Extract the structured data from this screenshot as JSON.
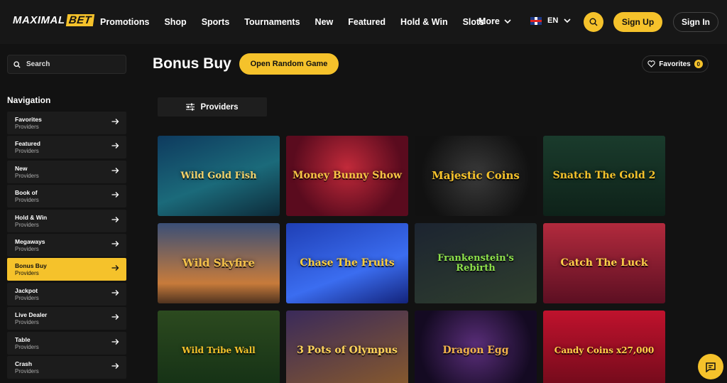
{
  "header": {
    "logo_part1": "MAXIMAL",
    "logo_part2": "BET",
    "nav": [
      "Promotions",
      "Shop",
      "Sports",
      "Tournaments",
      "New",
      "Featured",
      "Hold & Win",
      "Slots"
    ],
    "more_label": "More",
    "language": "EN",
    "signup_label": "Sign Up",
    "signin_label": "Sign In"
  },
  "sidebar": {
    "search_placeholder": "Search",
    "nav_title": "Navigation",
    "items": [
      {
        "label": "Favorites",
        "sub": "Providers"
      },
      {
        "label": "Featured",
        "sub": "Providers"
      },
      {
        "label": "New",
        "sub": "Providers"
      },
      {
        "label": "Book of",
        "sub": "Providers"
      },
      {
        "label": "Hold & Win",
        "sub": "Providers"
      },
      {
        "label": "Megaways",
        "sub": "Providers"
      },
      {
        "label": "Bonus Buy",
        "sub": "Providers"
      },
      {
        "label": "Jackpot",
        "sub": "Providers"
      },
      {
        "label": "Live Dealer",
        "sub": "Providers"
      },
      {
        "label": "Table",
        "sub": "Providers"
      },
      {
        "label": "Crash",
        "sub": "Providers"
      }
    ],
    "active_index": 6
  },
  "main": {
    "title": "Bonus Buy",
    "random_button": "Open Random Game",
    "favorites_label": "Favorites",
    "favorites_count": "0",
    "providers_label": "Providers"
  },
  "games": [
    {
      "title": "Wild Gold Fish"
    },
    {
      "title": "Money Bunny Show"
    },
    {
      "title": "Majestic Coins"
    },
    {
      "title": "Snatch The Gold 2"
    },
    {
      "title": "Wild Skyfire"
    },
    {
      "title": "Chase The Fruits"
    },
    {
      "title": "Frankenstein's Rebirth"
    },
    {
      "title": "Catch The Luck"
    },
    {
      "title": "Wild Tribe Wall"
    },
    {
      "title": "3 Pots of Olympus"
    },
    {
      "title": "Dragon Egg"
    },
    {
      "title": "Candy Coins x27,000"
    }
  ],
  "colors": {
    "accent": "#f5c22b",
    "bg": "#121212",
    "panel": "#1c1c1c"
  }
}
